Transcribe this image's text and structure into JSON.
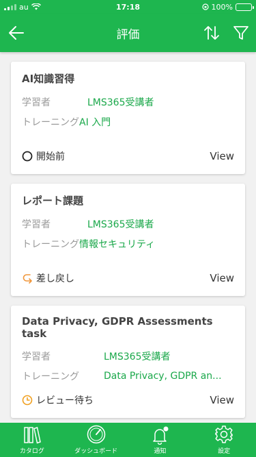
{
  "status_bar": {
    "carrier": "au",
    "time": "17:18",
    "battery": "100%"
  },
  "header": {
    "title": "評価"
  },
  "cards": [
    {
      "title": "AI知識習得",
      "learner_label": "学習者",
      "learner_value": "LMS365受講者",
      "training_label": "トレーニング",
      "training_value": "AI 入門",
      "status": "開始前",
      "status_icon": "circle-icon",
      "status_color": "#222222",
      "view": "View"
    },
    {
      "title": "レポート課題",
      "learner_label": "学習者",
      "learner_value": "LMS365受講者",
      "training_label": "トレーニング",
      "training_value": "情報セキュリティ",
      "status": "差し戻し",
      "status_icon": "return-arrow-icon",
      "status_color": "#f0963a",
      "view": "View"
    },
    {
      "title": "Data Privacy, GDPR  Assessments task",
      "learner_label": "学習者",
      "learner_value": "LMS365受講者",
      "training_label": "トレーニング",
      "training_value": "Data Privacy, GDPR an...",
      "status": "レビュー待ち",
      "status_icon": "clock-icon",
      "status_color": "#f0a020",
      "view": "View"
    }
  ],
  "bottom_nav": [
    {
      "label": "カタログ",
      "icon": "books-icon"
    },
    {
      "label": "ダッシュボード",
      "icon": "gauge-icon"
    },
    {
      "label": "通知",
      "icon": "bell-icon"
    },
    {
      "label": "設定",
      "icon": "gear-icon"
    }
  ],
  "colors": {
    "brand": "#1eb64f",
    "value_text": "#1aa84a"
  }
}
